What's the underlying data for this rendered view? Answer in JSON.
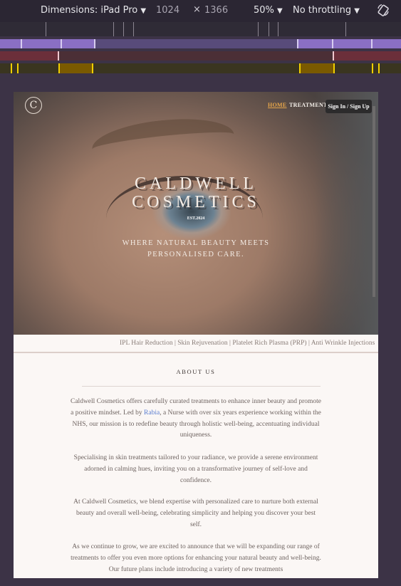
{
  "devtools": {
    "dimensions_label": "Dimensions: iPad Pro",
    "width": "1024",
    "times": "×",
    "height": "1366",
    "zoom": "50%",
    "throttling": "No throttling",
    "rotate_icon": "rotate-icon"
  },
  "nav": {
    "logo_glyph": "C",
    "home": "HOME",
    "treatments": "TREATMENTS",
    "sign_in": "Sign In / Sign Up"
  },
  "hero": {
    "brand_line1": "CALDWELL",
    "brand_line2": "COSMETICS",
    "est": "EST.2024",
    "tagline_line1": "WHERE NATURAL BEAUTY MEETS",
    "tagline_line2": "PERSONALISED CARE."
  },
  "ticker": {
    "text": "IPL Hair Reduction | Skin Rejuvenation | Platelet Rich Plasma (PRP) | Anti Wrinkle Injections"
  },
  "about": {
    "title": "ABOUT US",
    "p1_before": "Caldwell Cosmetics offers carefully curated treatments to enhance inner beauty and promote a positive mindset. Led by ",
    "p1_name": "Rabia",
    "p1_after": ", a Nurse with over six years experience working within the NHS, our mission is to redefine beauty through holistic well-being, accentuating individual uniqueness.",
    "p2": "Specialising in skin treatments tailored to your radiance, we provide a serene environment adorned in calming hues, inviting you on a transformative journey of self-love and confidence.",
    "p3": "At Caldwell Cosmetics, we blend expertise with personalized care to nurture both external beauty and overall well-being, celebrating simplicity and helping you discover your best self.",
    "p4": "As we continue to grow, we are excited to announce that we will be expanding our range of treatments to offer you even more options for enhancing your natural beauty and well-being. Our future plans include introducing a variety of new treatments"
  }
}
